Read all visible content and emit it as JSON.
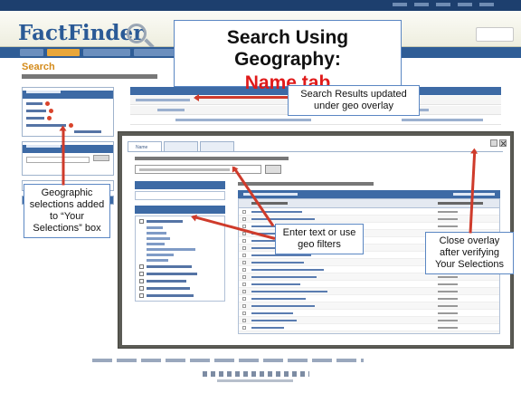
{
  "slide": {
    "title_line1": "Search Using Geography:",
    "title_line2": "Name tab",
    "callouts": {
      "search_results": "Search Results updated under geo overlay",
      "geographic_selections": "Geographic selections added to “Your Selections” box",
      "enter_text": "Enter text or use geo filters",
      "close_overlay": "Close overlay after verifying Your Selections"
    },
    "accent_color": "#e01a1a",
    "arrow_color": "#cf3b2b",
    "callout_border_color": "#5b87c3"
  },
  "app": {
    "name": "FactFinder",
    "heading": "Search",
    "icon": "magnifier-icon"
  },
  "geo_overlay": {
    "tabs": [
      "Name",
      "",
      ""
    ],
    "active_tab": "Name"
  }
}
